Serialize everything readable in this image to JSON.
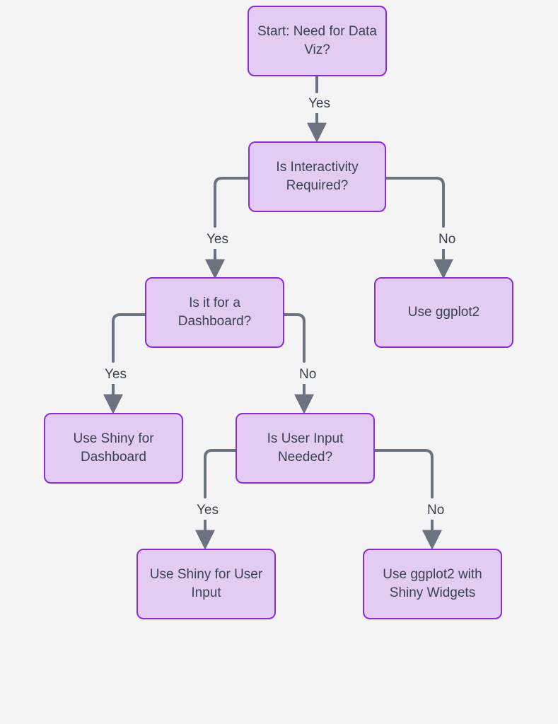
{
  "nodes": {
    "start": {
      "text": "Start: Need for Data Viz?"
    },
    "interact": {
      "text": "Is Interactivity Required?"
    },
    "dashboard": {
      "text": "Is it for a Dashboard?"
    },
    "ggplot": {
      "text": "Use ggplot2"
    },
    "shinydash": {
      "text": "Use Shiny for Dashboard"
    },
    "userinput": {
      "text": "Is User Input Needed?"
    },
    "shinyuser": {
      "text": "Use Shiny for User Input"
    },
    "ggwidgets": {
      "text": "Use ggplot2 with Shiny Widgets"
    }
  },
  "edges": {
    "start_yes": {
      "label": "Yes"
    },
    "interact_yes": {
      "label": "Yes"
    },
    "interact_no": {
      "label": "No"
    },
    "dashboard_yes": {
      "label": "Yes"
    },
    "dashboard_no": {
      "label": "No"
    },
    "userinput_yes": {
      "label": "Yes"
    },
    "userinput_no": {
      "label": "No"
    }
  },
  "colors": {
    "node_fill": "#e3ccf4",
    "node_border": "#8a2be2",
    "line": "#6b7280",
    "text": "#3a4252",
    "bg": "#f4f4f4"
  }
}
